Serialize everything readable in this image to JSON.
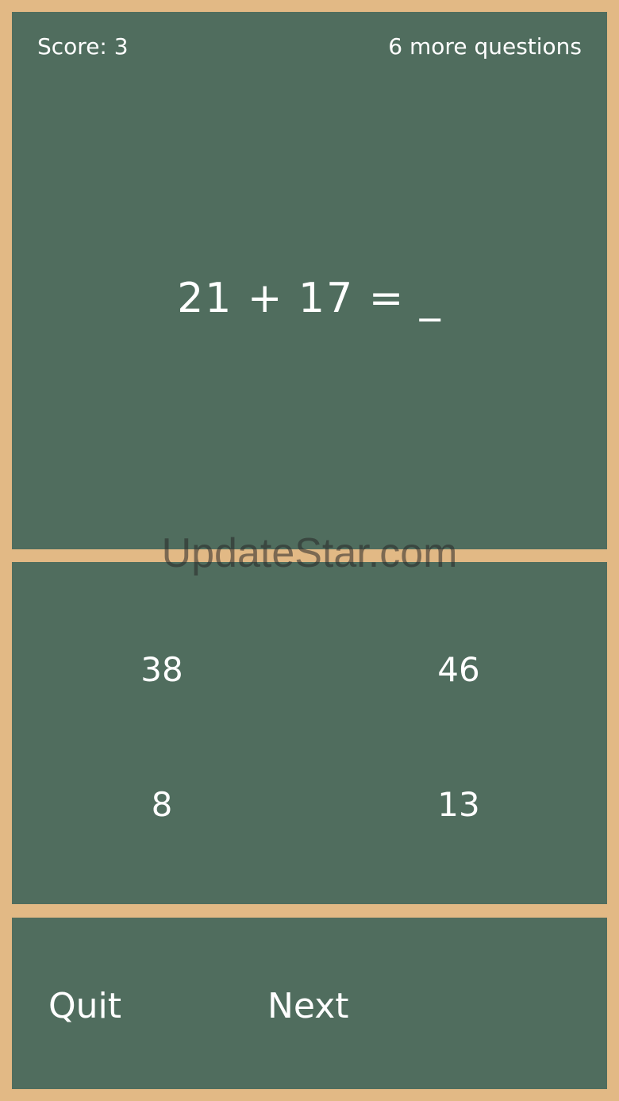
{
  "header": {
    "score": "Score: 3",
    "remaining": "6 more questions"
  },
  "question": {
    "equation": "21 + 17 = _"
  },
  "answers": [
    "38",
    "46",
    "8",
    "13"
  ],
  "controls": {
    "quit_label": "Quit",
    "next_label": "Next"
  },
  "watermark": "UpdateStar.com",
  "colors": {
    "board": "#506d5e",
    "frame": "#e2b985",
    "text": "#ffffff"
  }
}
